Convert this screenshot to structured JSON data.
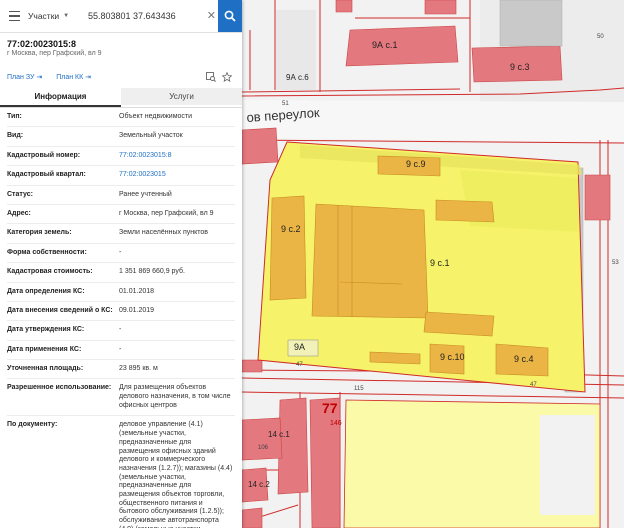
{
  "search": {
    "type_label": "Участки",
    "query": "55.803801 37.643436",
    "clear_symbol": "✕"
  },
  "object": {
    "number": "77:02:0023015:8",
    "address": "г Москва, пер Графский, вл 9",
    "plan_zu": "План ЗУ ⇥",
    "plan_kk": "План КК ⇥"
  },
  "tabs": {
    "info": "Информация",
    "services": "Услуги"
  },
  "rows": [
    {
      "k": "Тип:",
      "v": "Объект недвижимости"
    },
    {
      "k": "Вид:",
      "v": "Земельный участок"
    },
    {
      "k": "Кадастровый номер:",
      "v": "77:02:0023015:8",
      "link": true
    },
    {
      "k": "Кадастровый квартал:",
      "v": "77:02:0023015",
      "link": true
    },
    {
      "k": "Статус:",
      "v": "Ранее учтенный"
    },
    {
      "k": "Адрес:",
      "v": "г Москва, пер Графский, вл 9"
    },
    {
      "k": "Категория земель:",
      "v": "Земли населённых пунктов"
    },
    {
      "k": "Форма собственности:",
      "v": "-"
    },
    {
      "k": "Кадастровая стоимость:",
      "v": "1 351 869 660,9 руб."
    },
    {
      "k": "Дата определения КС:",
      "v": "01.01.2018"
    },
    {
      "k": "Дата внесения сведений о КС:",
      "v": "09.01.2019"
    },
    {
      "k": "Дата утверждения КС:",
      "v": "-"
    },
    {
      "k": "Дата применения КС:",
      "v": "-"
    },
    {
      "k": "Уточненная площадь:",
      "v": "23 895 кв. м"
    },
    {
      "k": "Разрешенное использование:",
      "v": "Для размещения объектов\nделового назначения, в том числе\nофисных центров"
    },
    {
      "k": "По документу:",
      "v": "деловое управление (4.1)\n(земельные участки,\nпредназначенные для\nразмещения офисных зданий\nделового и коммерческого\nназначения (1.2.7)); магазины (4.4)\n(земельные участки,\nпредназначенные для\nразмещения объектов торговли,\nобщественного питания и\nбытового обслуживания (1.2.5));\nобслуживание автотранспорта\n(4.9) (земельные участки,\nпредназначенные для"
    }
  ],
  "map_labels": {
    "street": "ов переулок",
    "b9a_s1": "9А с.1",
    "b9_s3": "9 с.3",
    "b9a_s6": "9А с.6",
    "b9_s9": "9 с.9",
    "b9_s2": "9 с.2",
    "b9_s1": "9 с.1",
    "b9a": "9А",
    "b9_s10": "9 с.10",
    "b9_s4": "9 с.4",
    "b14_s1": "14 с.1",
    "b14_s2": "14 с.2",
    "kv77": "77",
    "n146": "146",
    "n51": "51",
    "n50": "50",
    "n47a": "47",
    "n47b": "47",
    "n115": "115",
    "n106": "106",
    "n53": "53"
  }
}
